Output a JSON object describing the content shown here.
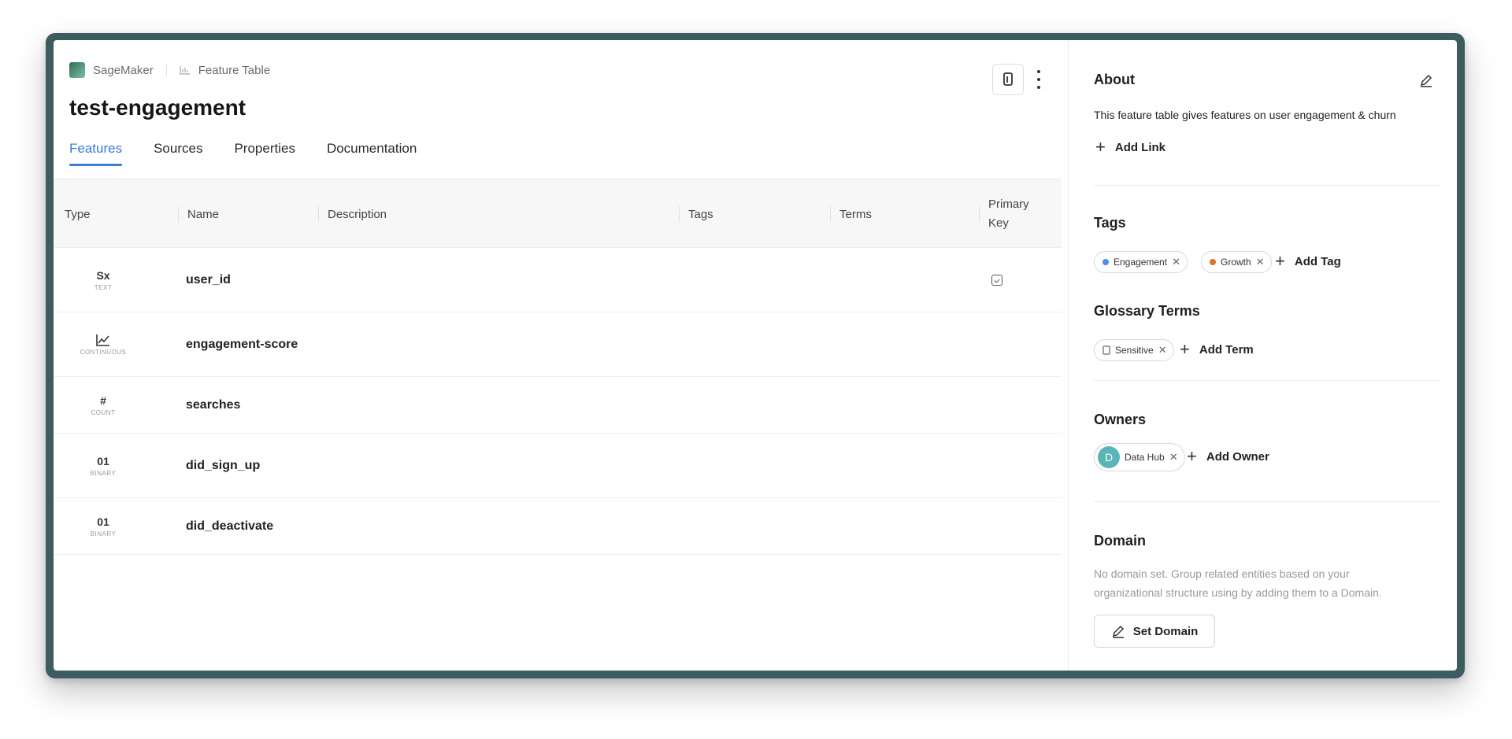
{
  "breadcrumb": {
    "platform": "SageMaker",
    "entity_type": "Feature Table"
  },
  "title": "test-engagement",
  "tabs": [
    {
      "label": "Features",
      "active": true
    },
    {
      "label": "Sources"
    },
    {
      "label": "Properties"
    },
    {
      "label": "Documentation"
    }
  ],
  "table": {
    "headers": {
      "type": "Type",
      "name": "Name",
      "description": "Description",
      "tags": "Tags",
      "terms": "Terms",
      "primary_key_1": "Primary",
      "primary_key_2": "Key"
    },
    "rows": [
      {
        "type_glyph": "Sx",
        "type_label": "TEXT",
        "name": "user_id",
        "primary_key": true
      },
      {
        "type_glyph": "↗",
        "type_label": "CONTINUOUS",
        "name": "engagement-score",
        "primary_key": false
      },
      {
        "type_glyph": "#",
        "type_label": "COUNT",
        "name": "searches",
        "primary_key": false
      },
      {
        "type_glyph": "01",
        "type_label": "BINARY",
        "name": "did_sign_up",
        "primary_key": false
      },
      {
        "type_glyph": "01",
        "type_label": "BINARY",
        "name": "did_deactivate",
        "primary_key": false
      }
    ]
  },
  "sidebar": {
    "about": {
      "title": "About",
      "description": "This feature table gives features on user engagement & churn",
      "add_link": "Add Link"
    },
    "tags": {
      "title": "Tags",
      "items": [
        {
          "label": "Engagement",
          "color": "#4a90e2"
        },
        {
          "label": "Growth",
          "color": "#e0702a"
        }
      ],
      "add_label": "Add Tag"
    },
    "glossary": {
      "title": "Glossary Terms",
      "items": [
        {
          "label": "Sensitive"
        }
      ],
      "add_label": "Add Term"
    },
    "owners": {
      "title": "Owners",
      "items": [
        {
          "initial": "D",
          "label": "Data Hub"
        }
      ],
      "add_label": "Add Owner"
    },
    "domain": {
      "title": "Domain",
      "empty_text_1": "No domain set. Group related entities based on your",
      "empty_text_2": "organizational structure using by adding them to a Domain.",
      "set_label": "Set Domain"
    }
  },
  "colors": {
    "accent": "#3a7bd5",
    "frame": "#3d5c5f",
    "avatar": "#5ab5b8"
  }
}
